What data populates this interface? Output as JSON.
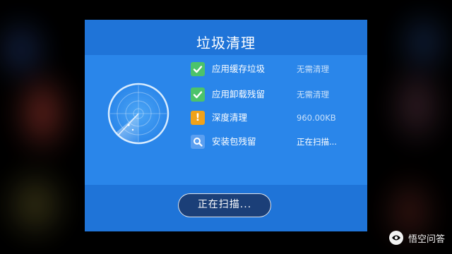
{
  "dialog": {
    "title": "垃圾清理",
    "items": [
      {
        "label": "应用缓存垃圾",
        "status": "无需清理",
        "icon": "check-icon"
      },
      {
        "label": "应用卸载残留",
        "status": "无需清理",
        "icon": "check-icon"
      },
      {
        "label": "深度清理",
        "status": "960.00KB",
        "icon": "warning-icon"
      },
      {
        "label": "安装包残留",
        "status": "正在扫描...",
        "icon": "search-icon"
      }
    ],
    "scan_button": "正在扫描..."
  },
  "watermark": {
    "text": "悟空问答"
  },
  "colors": {
    "panel": "#1f74d8",
    "content": "#2a86ea",
    "check": "#4cc36a",
    "warning": "#f0a21a",
    "button": "#1b3f78"
  }
}
